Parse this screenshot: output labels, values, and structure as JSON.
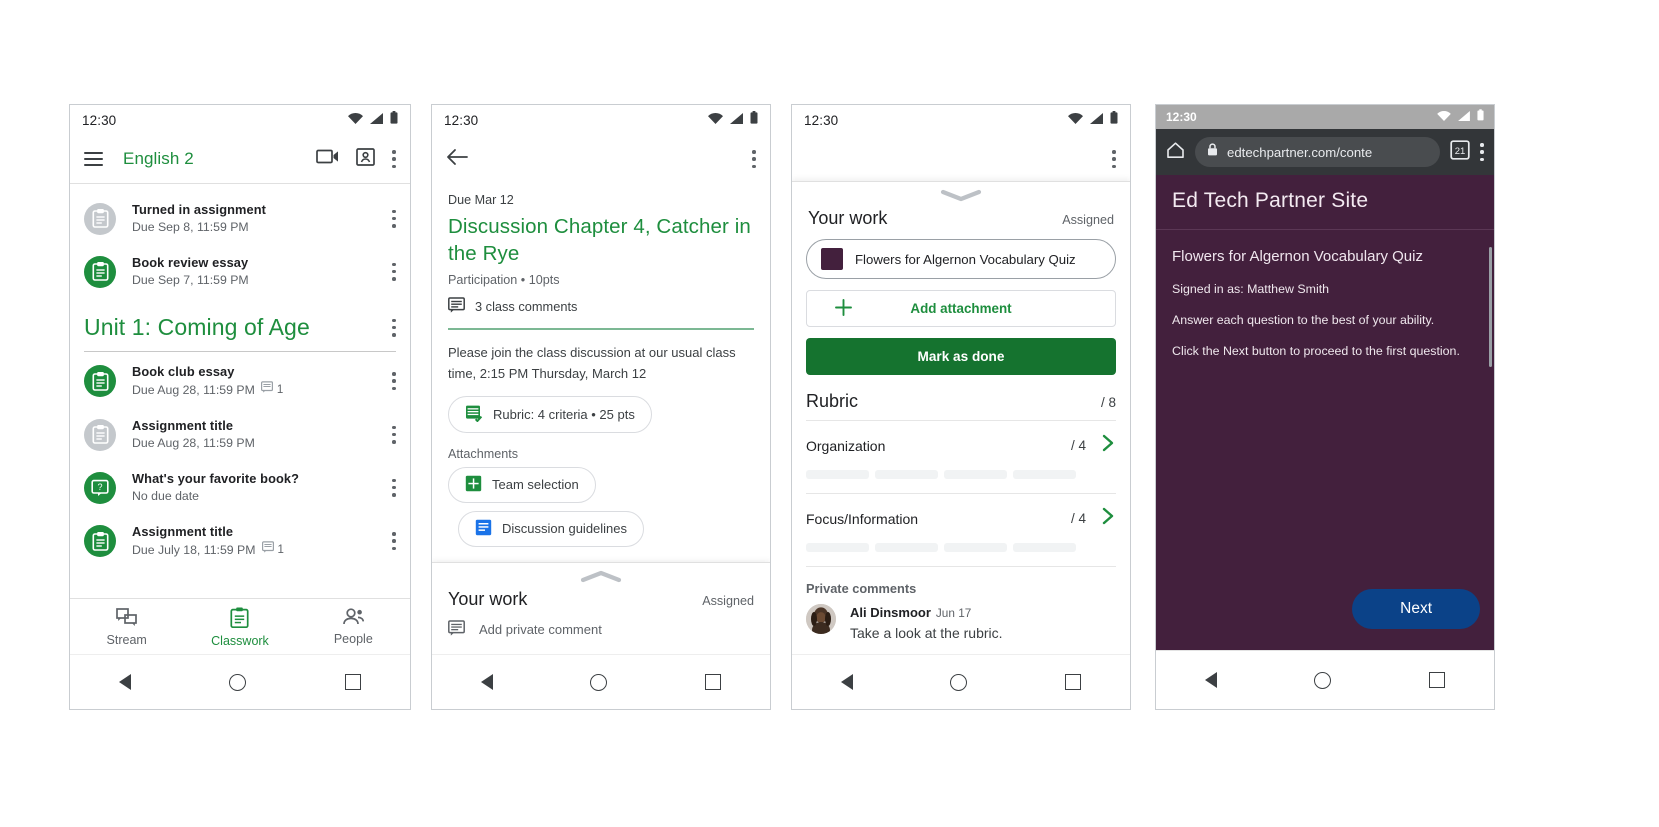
{
  "phone1": {
    "status": {
      "time": "12:30"
    },
    "appbar": {
      "title": "English 2"
    },
    "top_items": [
      {
        "title": "Turned in assignment",
        "sub": "Due Sep 8, 11:59 PM",
        "icon": "assignment-icon",
        "state": "grey",
        "comments": ""
      },
      {
        "title": "Book review essay",
        "sub": "Due Sep 7, 11:59 PM",
        "icon": "assignment-icon",
        "state": "green",
        "comments": ""
      }
    ],
    "unit": {
      "title": "Unit 1: Coming of Age"
    },
    "unit_items": [
      {
        "title": "Book club essay",
        "sub": "Due Aug 28, 11:59 PM",
        "icon": "assignment-icon",
        "state": "green",
        "comments": "1"
      },
      {
        "title": "Assignment title",
        "sub": "Due Aug 28, 11:59 PM",
        "icon": "assignment-icon",
        "state": "grey",
        "comments": ""
      },
      {
        "title": "What's your favorite book?",
        "sub": "No due date",
        "icon": "question-icon",
        "state": "green",
        "comments": ""
      },
      {
        "title": "Assignment title",
        "sub": "Due July 18, 11:59 PM",
        "icon": "assignment-icon",
        "state": "green",
        "comments": "1"
      }
    ],
    "bottom_nav": [
      {
        "label": "Stream",
        "icon": "stream-icon",
        "active": false
      },
      {
        "label": "Classwork",
        "icon": "classwork-icon",
        "active": true
      },
      {
        "label": "People",
        "icon": "people-icon",
        "active": false
      }
    ]
  },
  "phone2": {
    "status": {
      "time": "12:30"
    },
    "detail": {
      "due": "Due Mar 12",
      "title": "Discussion Chapter 4, Catcher in the Rye",
      "meta": "Participation • 10pts",
      "comments": "3 class comments",
      "body": "Please join the class discussion at our usual class time, 2:15 PM Thursday, March 12",
      "rubric_chip": "Rubric: 4 criteria • 25 pts",
      "attachments_label": "Attachments",
      "attachments": [
        {
          "label": "Team selection",
          "icon": "google-sheets-icon"
        },
        {
          "label": "Discussion guidelines",
          "icon": "google-docs-icon"
        }
      ]
    },
    "your_work": {
      "title": "Your work",
      "status": "Assigned",
      "private_comment_placeholder": "Add private comment"
    }
  },
  "phone3": {
    "status": {
      "time": "12:30"
    },
    "your_work": {
      "title": "Your work",
      "status": "Assigned",
      "attachment": {
        "label": "Flowers for Algernon Vocabulary Quiz",
        "icon": "quiz-thumbnail",
        "color": "#43203d"
      },
      "add_attachment": "Add attachment",
      "mark_as_done": "Mark as done"
    },
    "rubric": {
      "title": "Rubric",
      "total": "/ 8",
      "criteria": [
        {
          "name": "Organization",
          "points": "/ 4",
          "levels": 4
        },
        {
          "name": "Focus/Information",
          "points": "/ 4",
          "levels": 4
        }
      ]
    },
    "private_comments": {
      "title": "Private comments",
      "comments": [
        {
          "author": "Ali Dinsmoor",
          "date": "Jun 17",
          "text": "Take a look at the rubric."
        }
      ]
    }
  },
  "phone4": {
    "status": {
      "time": "12:30"
    },
    "browser": {
      "url": "edtechpartner.com/conte",
      "tab_count": "21"
    },
    "page": {
      "site_title": "Ed Tech Partner Site",
      "quiz_title": "Flowers for Algernon Vocabulary Quiz",
      "signed_in": "Signed in as: Matthew Smith",
      "line1": "Answer each question to the best of your ability.",
      "line2": "Click the Next button to proceed to the first question.",
      "next_button": "Next",
      "bg_color": "#43203d",
      "next_color": "#0b4288"
    }
  }
}
